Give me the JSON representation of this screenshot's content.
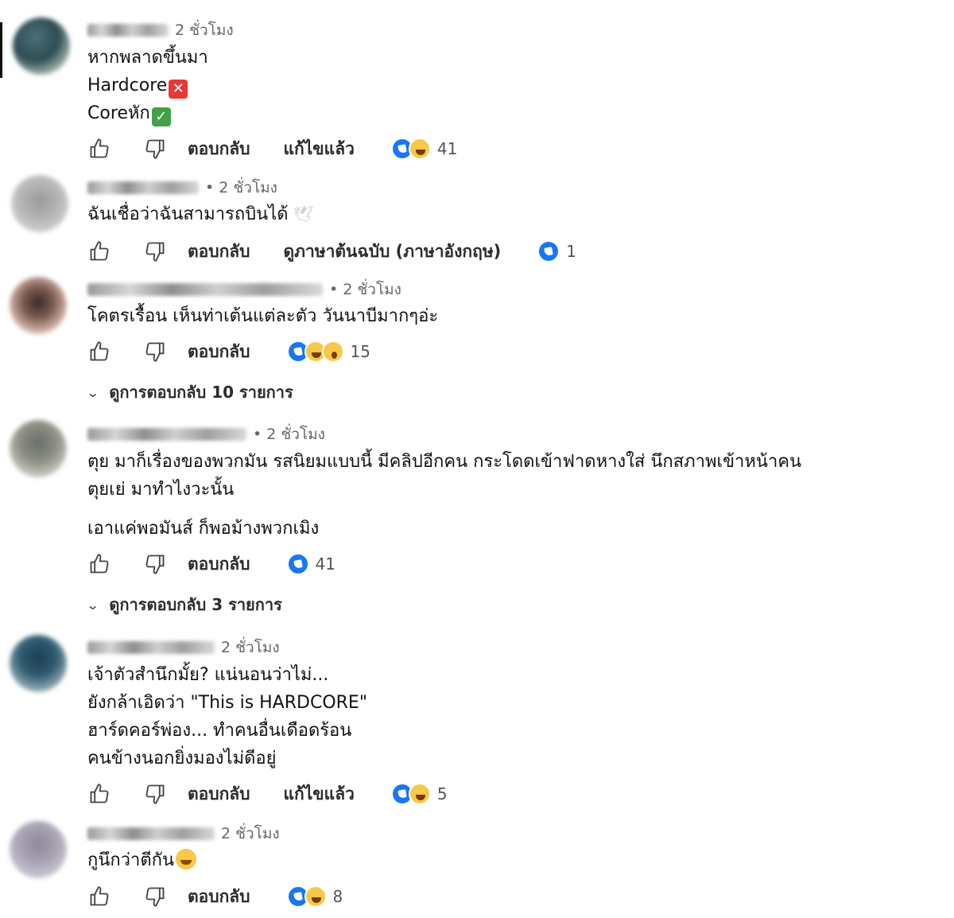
{
  "labels": {
    "reply": "ตอบกลับ",
    "edited": "แก้ไขแล้ว",
    "see_translation": "ดูภาษาต้นฉบับ (ภาษาอังกฤษ)"
  },
  "icons": {
    "like": "thumbs-up-outline-icon",
    "dislike": "thumbs-down-outline-icon",
    "reaction_like": "like-reaction-icon",
    "reaction_haha": "haha-reaction-icon",
    "reaction_wow": "wow-reaction-icon"
  },
  "colors": {
    "like_blue": "#1877f2",
    "text": "#111111",
    "muted": "#666666"
  },
  "comments": [
    {
      "time": "2 ชั่วโมง",
      "lines": [
        "หากพลาดขึ้นมา",
        "Hardcore",
        "Coreหัก"
      ],
      "reaction_count": "41"
    },
    {
      "time": "• 2 ชั่วโมง",
      "lines": [
        "ฉันเชื่อว่าฉันสามารถบินได้"
      ],
      "reaction_count": "1"
    },
    {
      "time": "• 2 ชั่วโมง",
      "lines": [
        "โคตรเรื้อน เห็นท่าเต้นแต่ละตัว วันนาบีมากๆอ่ะ"
      ],
      "reaction_count": "15",
      "view_replies": "ดูการตอบกลับ 10 รายการ"
    },
    {
      "time": "• 2 ชั่วโมง",
      "lines": [
        "ตุย มาก็เรื่องของพวกมัน รสนิยมแบบนี้ มีคลิปอีกคน กระโดดเข้าฟาดหางใส่ นึกสภาพเข้าหน้าคน",
        "ตุยเย่ มาทำไงวะนั้น",
        "เอาแค่พอมันส์ ก็พอม้างพวกเมิง"
      ],
      "reaction_count": "41",
      "view_replies": "ดูการตอบกลับ 3 รายการ"
    },
    {
      "time": "2 ชั่วโมง",
      "lines": [
        "เจ้าตัวสำนึกมั้ย? แน่นอนว่าไม่...",
        "ยังกล้าเอิดว่า \"This is HARDCORE\"",
        "ฮาร์ดคอร์พ่อง... ทำคนอื่นเดือดร้อน",
        "คนข้างนอกยิ่งมองไม่ดีอยู่"
      ],
      "reaction_count": "5"
    },
    {
      "time": "2 ชั่วโมง",
      "lines": [
        "กูนึกว่าตีกัน"
      ],
      "reaction_count": "8"
    }
  ]
}
